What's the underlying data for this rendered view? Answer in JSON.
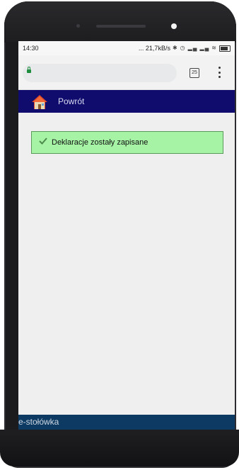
{
  "status_bar": {
    "time": "14:30",
    "network_speed": "... 21,7kB/s",
    "icons": [
      "bluetooth-icon",
      "alarm-icon",
      "signal-icon",
      "signal-icon",
      "wifi-icon",
      "battery-icon"
    ]
  },
  "browser": {
    "tabs_count": "25"
  },
  "nav": {
    "back_label": "Powrót"
  },
  "alert": {
    "message": "Deklaracje zostały zapisane"
  },
  "footer": {
    "label": "e-stołówka"
  },
  "colors": {
    "nav_bg": "#0f0c6e",
    "alert_bg": "#a6f3a6",
    "footer_bg": "#0c3a63",
    "lock": "#1e8e3e"
  }
}
